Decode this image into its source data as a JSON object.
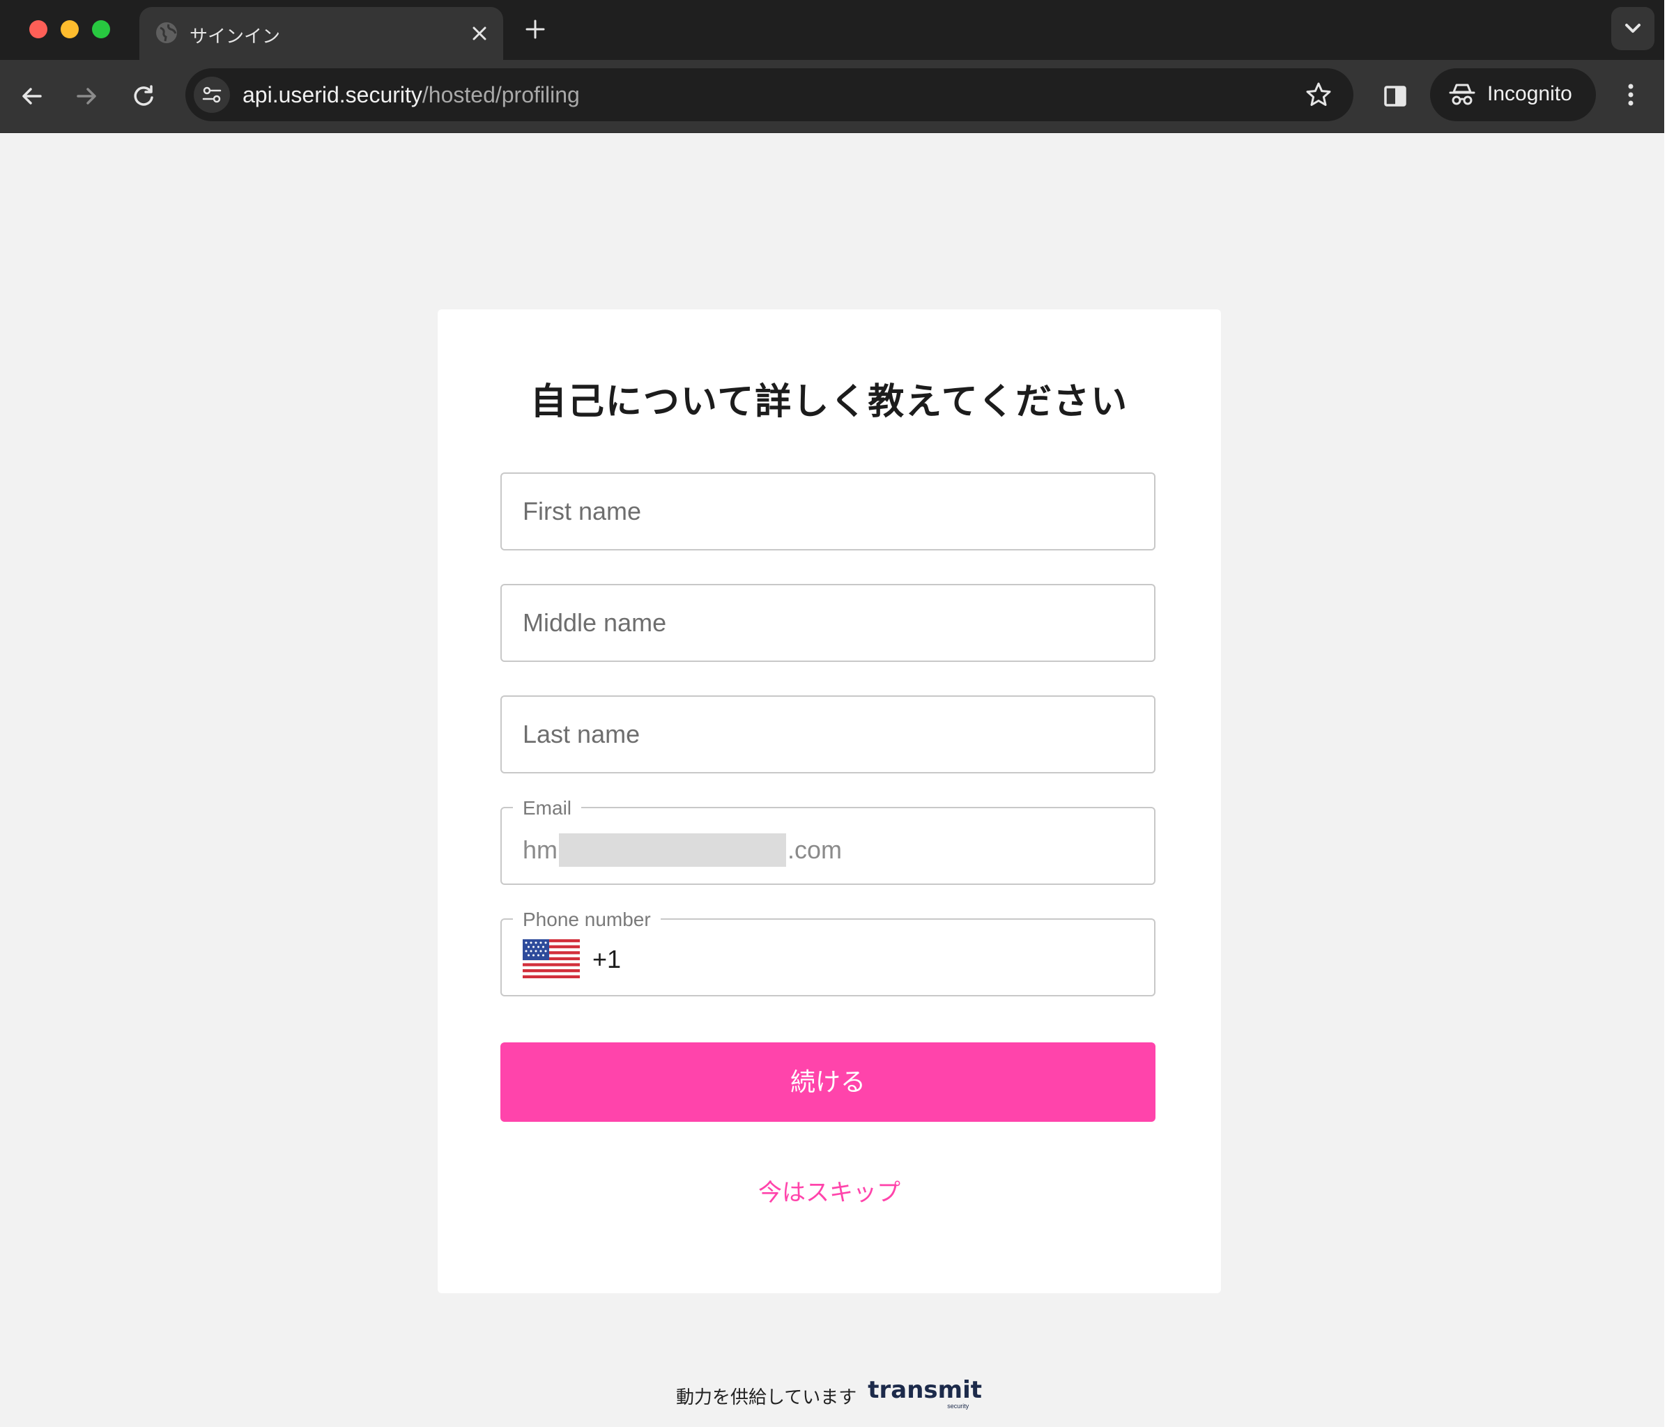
{
  "browser": {
    "tab_title": "サインイン",
    "url_host": "api.userid.security",
    "url_path": "/hosted/profiling",
    "incognito_label": "Incognito"
  },
  "form": {
    "title": "自己について詳しく教えてください",
    "first_name_placeholder": "First name",
    "middle_name_placeholder": "Middle name",
    "last_name_placeholder": "Last name",
    "email_label": "Email",
    "email_prefix": "hm",
    "email_suffix": ".com",
    "phone_label": "Phone number",
    "phone_country_icon": "us-flag-icon",
    "phone_dial_code": "+1",
    "continue_label": "続ける",
    "skip_label": "今はスキップ"
  },
  "footer": {
    "powered_by": "動力を供給しています",
    "brand_name": "transmit",
    "brand_sub": "security"
  },
  "colors": {
    "accent": "#ff44ab",
    "chrome_dark": "#1f1f1f",
    "chrome_mid": "#353535",
    "page_bg": "#f2f2f2"
  }
}
